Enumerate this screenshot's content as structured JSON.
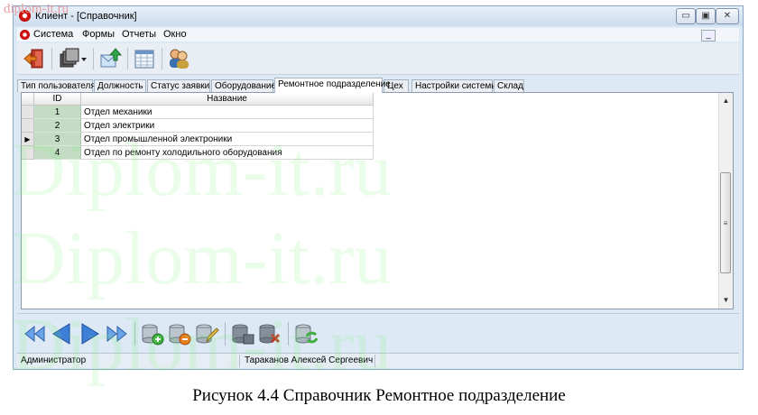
{
  "page_watermark": "diplom-it.ru",
  "overlay_watermark": "Diplom-it.ru",
  "window": {
    "title": "Клиент - [Справочник]",
    "minimize_glyph": "▭",
    "maximize_glyph": "▣",
    "close_glyph": "✕",
    "mdi_minimize_glyph": "_"
  },
  "menu": [
    {
      "label": "Система"
    },
    {
      "label": "Формы"
    },
    {
      "label": "Отчеты"
    },
    {
      "label": "Окно"
    }
  ],
  "toolbar_icons": [
    "exit-icon",
    "windows-dropdown-icon",
    "export-icon",
    "calendar-table-icon",
    "users-icon"
  ],
  "tabs": [
    {
      "label": "Тип пользователя"
    },
    {
      "label": "Должность"
    },
    {
      "label": "Статус заявки"
    },
    {
      "label": "Оборудование"
    },
    {
      "label": "Ремонтное подразделение",
      "active": true
    },
    {
      "label": "Цех"
    },
    {
      "label": "Настройки системы"
    },
    {
      "label": "Склад"
    }
  ],
  "grid": {
    "columns": [
      "ID",
      "Название"
    ],
    "current_row_indicator": "▶",
    "rows": [
      {
        "id": "1",
        "name": "Отдел механики"
      },
      {
        "id": "2",
        "name": "Отдел электрики"
      },
      {
        "id": "3",
        "name": "Отдел промышленной электроники"
      },
      {
        "id": "4",
        "name": "Отдел по ремонту холодильного оборудования"
      }
    ],
    "current_row_index": 2
  },
  "scrollbar": {
    "up_glyph": "▲",
    "down_glyph": "▼",
    "grip_glyph": "≡"
  },
  "navigator_icons": [
    "first-record-icon",
    "prev-record-icon",
    "next-record-icon",
    "last-record-icon",
    "add-record-icon",
    "delete-record-icon",
    "edit-record-icon",
    "save-record-icon",
    "cancel-record-icon",
    "refresh-icon"
  ],
  "status": {
    "role": "Администратор",
    "user": "Тараканов Алексей Сергеевич"
  },
  "caption": "Рисунок 4.4 Справочник Ремонтное подразделение",
  "colors": {
    "id_column": "#c4dcc4",
    "nav_arrow": "#3d7fd9",
    "window_bg": "#dde9f5"
  }
}
